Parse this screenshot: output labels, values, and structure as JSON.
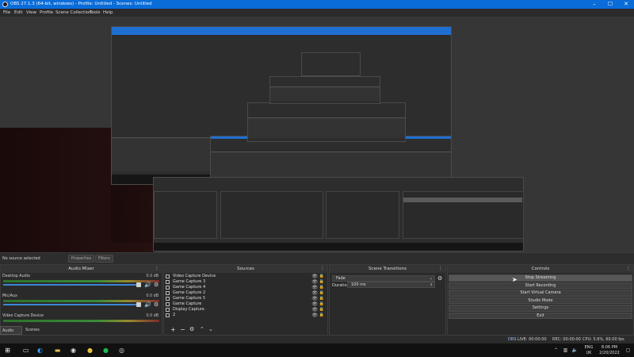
{
  "window": {
    "title": "OBS 27.1.3 (64-bit, windows) - Profile: Untitled - Scenes: Untitled",
    "controls": [
      "–",
      "☐",
      "✕"
    ]
  },
  "menu": [
    "File",
    "Edit",
    "View",
    "Profile",
    "Scene Collection",
    "Tools",
    "Help"
  ],
  "source_bar": {
    "no_source": "No source selected",
    "properties": "Properties",
    "filters": "Filters"
  },
  "audio_mixer": {
    "title": "Audio Mixer",
    "channels": [
      {
        "name": "Desktop Audio",
        "db": "0.0 dB",
        "level": 0.85
      },
      {
        "name": "Mic/Aux",
        "db": "0.0 dB",
        "level": 0.85
      },
      {
        "name": "Video Capture Device",
        "db": "0.0 dB",
        "level": 0.85
      }
    ]
  },
  "bottom_tabs": [
    "Audio Mixer",
    "Scenes"
  ],
  "sources": {
    "title": "Sources",
    "items": [
      "Video Capture Device",
      "Game Capture 3",
      "Game Capture 4",
      "Game Capture 2",
      "Game Capture 5",
      "Game Capture",
      "Display Capture",
      "2"
    ]
  },
  "scene_transitions": {
    "title": "Scene Transitions",
    "transition": "Fade",
    "duration_label": "Duration",
    "duration_value": "100 ms"
  },
  "controls": {
    "title": "Controls",
    "buttons": [
      "Stop Streaming",
      "Start Recording",
      "Start Virtual Camera",
      "Studio Mode",
      "Settings",
      "Exit"
    ]
  },
  "status": {
    "dropped": "DRS",
    "live": "LIVE: 00:00:00",
    "rec": "REC: 00:00:00",
    "cpu": "CPU: 5.6%, 60.00 fps"
  },
  "taskbar": {
    "lang": "ENG",
    "region": "UK",
    "time": "8:06 PM",
    "date": "2/20/2022"
  },
  "colors": {
    "titlebar": "#0a6cd8",
    "panel": "#2a2a2a",
    "accent": "#3c87d6"
  }
}
